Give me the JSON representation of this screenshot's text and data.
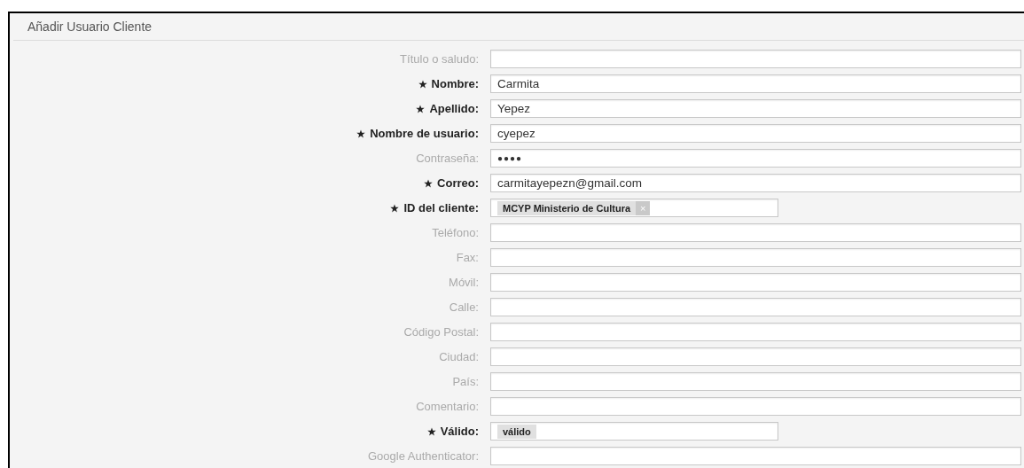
{
  "panel": {
    "title": "Añadir Usuario Cliente"
  },
  "fields": [
    {
      "label": "Título o saludo:",
      "required": false,
      "kind": "text"
    },
    {
      "label": "Nombre:",
      "required": true,
      "kind": "text",
      "value": "Carmita"
    },
    {
      "label": "Apellido:",
      "required": true,
      "kind": "text",
      "value": "Yepez"
    },
    {
      "label": "Nombre de usuario:",
      "required": true,
      "kind": "text",
      "value": "cyepez"
    },
    {
      "label": "Contraseña:",
      "required": false,
      "kind": "password",
      "value": "●●●●"
    },
    {
      "label": "Correo:",
      "required": true,
      "kind": "text",
      "value": "carmitayepezn@gmail.com"
    },
    {
      "label": "ID del cliente:",
      "required": true,
      "kind": "tags",
      "tag": "MCYP Ministerio de Cultura",
      "remove": "×"
    },
    {
      "label": "Teléfono:",
      "required": false,
      "kind": "text"
    },
    {
      "label": "Fax:",
      "required": false,
      "kind": "text"
    },
    {
      "label": "Móvil:",
      "required": false,
      "kind": "text"
    },
    {
      "label": "Calle:",
      "required": false,
      "kind": "text"
    },
    {
      "label": "Código Postal:",
      "required": false,
      "kind": "text"
    },
    {
      "label": "Ciudad:",
      "required": false,
      "kind": "text"
    },
    {
      "label": "País:",
      "required": false,
      "kind": "text"
    },
    {
      "label": "Comentario:",
      "required": false,
      "kind": "text"
    },
    {
      "label": "Válido:",
      "required": true,
      "kind": "select",
      "tag": "válido"
    },
    {
      "label": "Google Authenticator:",
      "required": false,
      "kind": "text"
    }
  ]
}
